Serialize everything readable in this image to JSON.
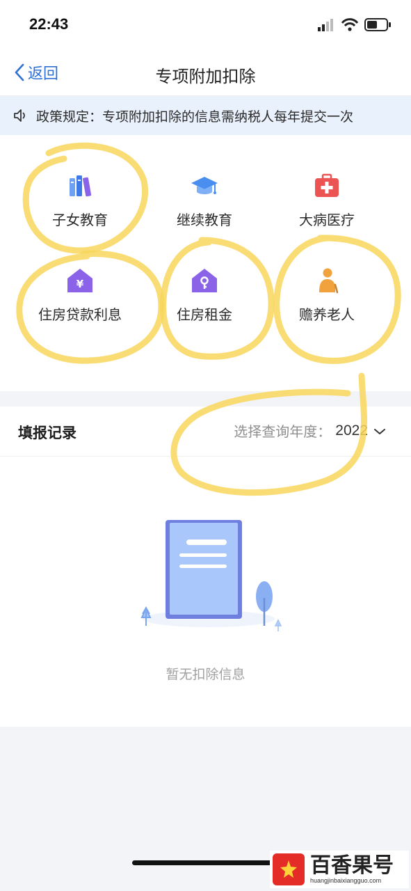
{
  "status_bar": {
    "time": "22:43"
  },
  "nav": {
    "back_label": "返回",
    "title": "专项附加扣除"
  },
  "notice": {
    "text": "政策规定：专项附加扣除的信息需纳税人每年提交一次"
  },
  "categories": [
    {
      "label": "子女教育",
      "icon": "books-icon"
    },
    {
      "label": "继续教育",
      "icon": "graduation-cap-icon"
    },
    {
      "label": "大病医疗",
      "icon": "first-aid-kit-icon"
    },
    {
      "label": "住房贷款利息",
      "icon": "house-yen-icon"
    },
    {
      "label": "住房租金",
      "icon": "house-key-icon"
    },
    {
      "label": "赡养老人",
      "icon": "elderly-person-icon"
    }
  ],
  "records": {
    "title": "填报记录",
    "year_label": "选择查询年度：",
    "year_value": "2022",
    "empty_text": "暂无扣除信息"
  },
  "watermark": {
    "brand": "百香果号",
    "url": "huangjinbaixiangguo.com"
  },
  "colors": {
    "accent_blue": "#2f6fd6",
    "notice_bg": "#e9f1fd",
    "highlight": "#f8d65a",
    "icon_purple": "#8a63e8",
    "icon_red": "#ec5353",
    "icon_orange": "#f2a23c"
  }
}
